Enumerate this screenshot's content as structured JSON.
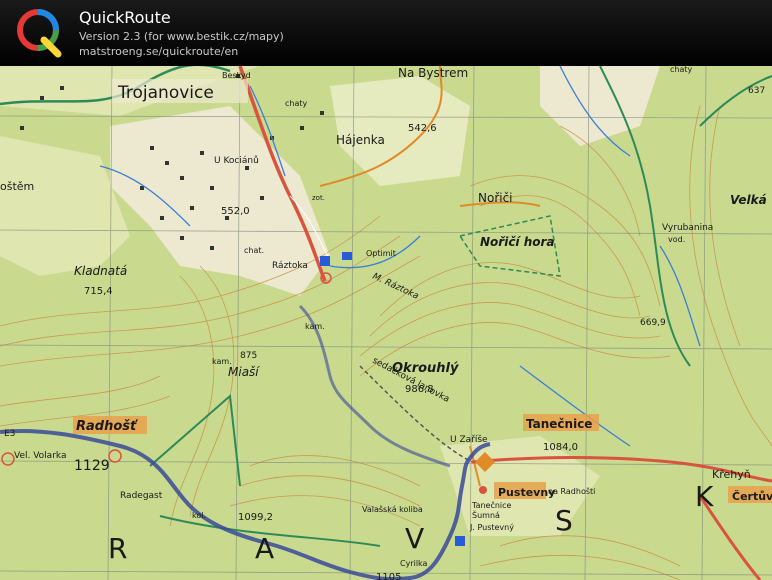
{
  "app": {
    "title": "QuickRoute",
    "version_line": "Version 2.3  (for www.bestik.cz/mapy)",
    "url_line": "matstroeng.se/quickroute/en",
    "logo_letter": "Q",
    "logo_colors": [
      "#e53935",
      "#1e88e5",
      "#43a047",
      "#fdd835"
    ]
  },
  "map": {
    "colors": {
      "forest": "#c9d98e",
      "open": "#ece9d0",
      "meadow": "#dfe6b0",
      "contour": "#c98f4a",
      "grid": "#7d8a7d",
      "stream": "#3b7fd6",
      "road_red": "#d9533e",
      "trail_green": "#2e8b57",
      "route": "#3a4a9a"
    },
    "labels": {
      "bystrem": "Na Bystrem",
      "trojanovice": "Trojanovice",
      "besky": "Beskyd",
      "chaty1": "chaty",
      "chaty2": "chaty",
      "hajenka": "Hájenka",
      "elev_5426": "542,6",
      "kocianu": "U Kociánů",
      "kostem": "oštěm",
      "elev_5520": "552,0",
      "zot": "zot.",
      "norici": "Nořiči",
      "norici_hora": "Nořičí hora",
      "velka": "Velká",
      "vyrubanina": "Vyrubanina",
      "vod": "vod.",
      "kladnata": "Kladnatá",
      "elev_7154": "715,4",
      "chat": "chat.",
      "raztoka": "Ráztoka",
      "optimit": "Optimit",
      "m_raztoka": "M. Ráztoka",
      "kam1": "kam.",
      "kam2": "kam.",
      "elev_875": "875",
      "miasi": "Miaší",
      "okrouhly": "Okrouhlý",
      "elev_9868": "986,8",
      "lanovka": "sedačková lanovka",
      "elev_6699": "669,9",
      "elev_637": "637",
      "radhost": "Radhošť",
      "volarka": "Vel. Volarka",
      "elev_1129": "1129",
      "e3": "E3",
      "radegast": "Radegast",
      "u_zarise": "U Zaříše",
      "tanecnice": "Tanečnice",
      "elev_10840": "1084,0",
      "krehyn": "Křehyň",
      "certuv": "Čertův",
      "pustevny": "Pustevny",
      "na_radhosti": "na Radhošti",
      "tanecnice2": "Tanečnice",
      "sumna": "Šumná",
      "j_pustevny": "J. Pustevný",
      "valasska": "Valašská koliba",
      "cyrilka": "Cyrilka",
      "kol": "kol.",
      "elev_10992": "1099,2",
      "elev_1105": "1105",
      "letter_r": "R",
      "letter_a": "A",
      "letter_v": "V",
      "letter_s": "S",
      "letter_k": "K"
    }
  }
}
